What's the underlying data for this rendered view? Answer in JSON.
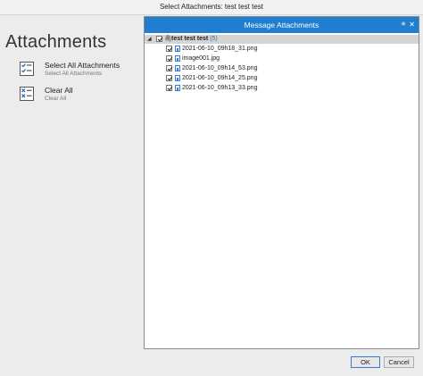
{
  "window": {
    "title": "Select Attachments: test test test"
  },
  "sidebar": {
    "title": "Attachments",
    "commands": [
      {
        "label": "Select All Attachments",
        "sublabel": "Select All Attachments",
        "icon": "select-all-icon"
      },
      {
        "label": "Clear All",
        "sublabel": "Clear All",
        "icon": "clear-all-icon"
      }
    ]
  },
  "dialog": {
    "title": "Message Attachments",
    "pin_glyph": "✳",
    "close_glyph": "✕",
    "tree": {
      "root": {
        "label": "test test test",
        "count": "(5)",
        "checked": true,
        "expanded": true
      },
      "files": [
        {
          "name": "2021-06-10_09h18_31.png",
          "checked": true
        },
        {
          "name": "image001.jpg",
          "checked": true
        },
        {
          "name": "2021-06-10_09h14_53.png",
          "checked": true
        },
        {
          "name": "2021-06-10_09h14_25.png",
          "checked": true
        },
        {
          "name": "2021-06-10_09h13_33.png",
          "checked": true
        }
      ]
    }
  },
  "buttons": {
    "ok": "OK",
    "cancel": "Cancel"
  },
  "colors": {
    "accent": "#1f7ed0",
    "background": "#ececec"
  }
}
